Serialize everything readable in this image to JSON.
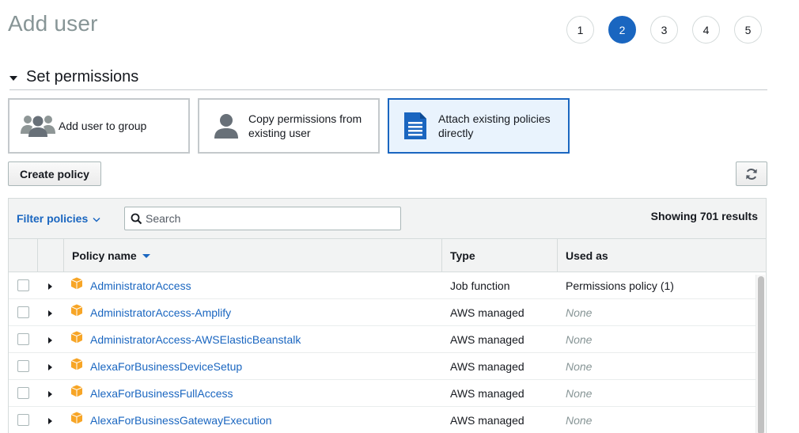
{
  "page": {
    "title": "Add user"
  },
  "steps": [
    {
      "label": "1",
      "active": false
    },
    {
      "label": "2",
      "active": true
    },
    {
      "label": "3",
      "active": false
    },
    {
      "label": "4",
      "active": false
    },
    {
      "label": "5",
      "active": false
    }
  ],
  "section": {
    "title": "Set permissions"
  },
  "options": [
    {
      "label": "Add user to group",
      "icon": "group-icon",
      "selected": false
    },
    {
      "label": "Copy permissions from existing user",
      "icon": "user-icon",
      "selected": false
    },
    {
      "label": "Attach existing policies directly",
      "icon": "document-icon",
      "selected": true
    }
  ],
  "actions": {
    "create_policy_label": "Create policy",
    "refresh_icon": "refresh-icon"
  },
  "filter": {
    "label": "Filter policies",
    "search_placeholder": "Search",
    "results_text": "Showing 701 results"
  },
  "table": {
    "columns": [
      "Policy name",
      "Type",
      "Used as"
    ],
    "sorted_column": "Policy name",
    "rows": [
      {
        "name": "AdministratorAccess",
        "type": "Job function",
        "used_as": "Permissions policy (1)"
      },
      {
        "name": "AdministratorAccess-Amplify",
        "type": "AWS managed",
        "used_as": "None"
      },
      {
        "name": "AdministratorAccess-AWSElasticBeanstalk",
        "type": "AWS managed",
        "used_as": "None"
      },
      {
        "name": "AlexaForBusinessDeviceSetup",
        "type": "AWS managed",
        "used_as": "None"
      },
      {
        "name": "AlexaForBusinessFullAccess",
        "type": "AWS managed",
        "used_as": "None"
      },
      {
        "name": "AlexaForBusinessGatewayExecution",
        "type": "AWS managed",
        "used_as": "None"
      }
    ]
  },
  "colors": {
    "accent": "#1a66c0",
    "selected_bg": "#e9f3fd",
    "policy_icon": "#f7a526"
  }
}
